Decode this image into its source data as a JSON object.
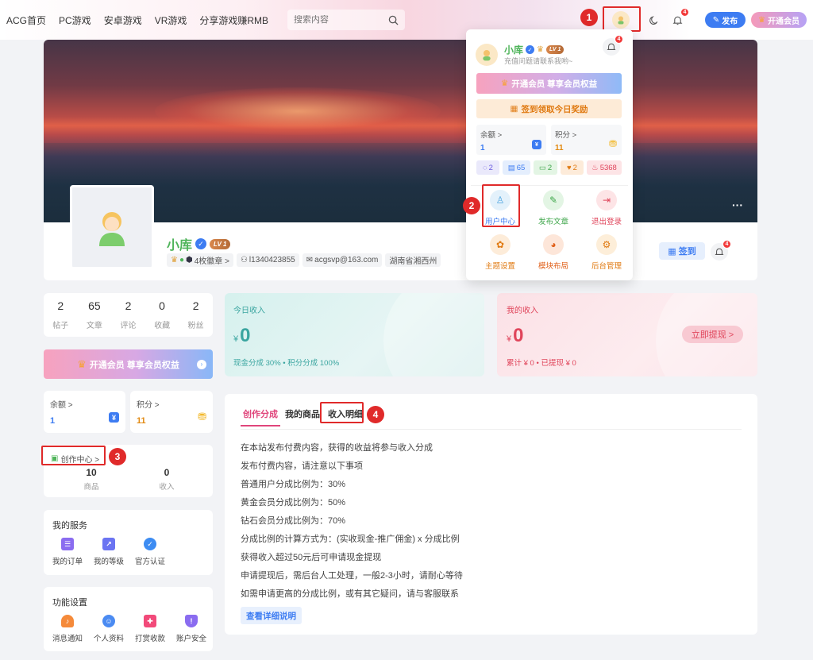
{
  "nav": {
    "links": [
      "ACG首页",
      "PC游戏",
      "安卓游戏",
      "VR游戏",
      "分享游戏赚RMB"
    ],
    "search_placeholder": "搜索内容",
    "notif_count": "4",
    "publish_label": "发布",
    "vip_label": "开通会员"
  },
  "annotations": [
    "1",
    "2",
    "3",
    "4"
  ],
  "profile": {
    "name": "小库",
    "level": "LV 1",
    "badges_label": "4枚徽章 >",
    "user_id": "l1340423855",
    "email": "acgsvp@163.com",
    "location": "湖南省湘西州",
    "signin_label": "签到",
    "more_glyph": "···",
    "notif_count": "4"
  },
  "stats": [
    {
      "value": "2",
      "label": "帖子"
    },
    {
      "value": "65",
      "label": "文章"
    },
    {
      "value": "2",
      "label": "评论"
    },
    {
      "value": "0",
      "label": "收藏"
    },
    {
      "value": "2",
      "label": "粉丝"
    }
  ],
  "vip_banner": "开通会员 尊享会员权益",
  "balance": {
    "label": "余额 >",
    "value": "1"
  },
  "points": {
    "label": "积分 >",
    "value": "11"
  },
  "creator": {
    "title": "创作中心 >",
    "items": [
      {
        "value": "10",
        "label": "商品"
      },
      {
        "value": "0",
        "label": "收入"
      }
    ]
  },
  "services": {
    "title": "我的服务",
    "items": [
      "我的订单",
      "我的等级",
      "官方认证"
    ]
  },
  "settings": {
    "title": "功能设置",
    "items": [
      "消息通知",
      "个人资料",
      "打赏收款",
      "账户安全"
    ]
  },
  "income_today": {
    "title": "今日收入",
    "currency": "¥",
    "amount": "0",
    "note": "现金分成 30% • 积分分成 100%"
  },
  "my_income": {
    "title": "我的收入",
    "currency": "¥",
    "amount": "0",
    "note": "累计 ¥ 0 • 已提现 ¥ 0",
    "withdraw_label": "立即提现 >"
  },
  "tabs": [
    "创作分成",
    "我的商品",
    "收入明细"
  ],
  "rules": [
    "在本站发布付费内容，获得的收益将参与收入分成",
    "发布付费内容，请注意以下事项",
    "普通用户分成比例为：30%",
    "黄金会员分成比例为：50%",
    "钻石会员分成比例为：70%",
    "分成比例的计算方式为：(实收现金-推广佣金) x 分成比例",
    "获得收入超过50元后可申请现金提现",
    "申请提现后，需后台人工处理，一般2-3小时，请耐心等待",
    "如需申请更高的分成比例，或有其它疑问，请与客服联系"
  ],
  "detail_button": "查看详细说明",
  "dropdown": {
    "name": "小库",
    "level": "LV 1",
    "subtitle": "充值问题请联系我哟~",
    "notif_count": "4",
    "vip_label": "开通会员 尊享会员权益",
    "signin_label": "签到领取今日奖励",
    "balance_label": "余额 >",
    "balance_value": "1",
    "points_label": "积分 >",
    "points_value": "11",
    "counts": [
      "2",
      "65",
      "2",
      "2",
      "5368"
    ],
    "menu": [
      "用户中心",
      "发布文章",
      "退出登录",
      "主题设置",
      "模块布局",
      "后台管理"
    ]
  },
  "colors": {
    "accent_blue": "#3d7cf2",
    "accent_green": "#4fb45a",
    "annotation_red": "#e02a2a",
    "tab_active": "#e0457b"
  }
}
